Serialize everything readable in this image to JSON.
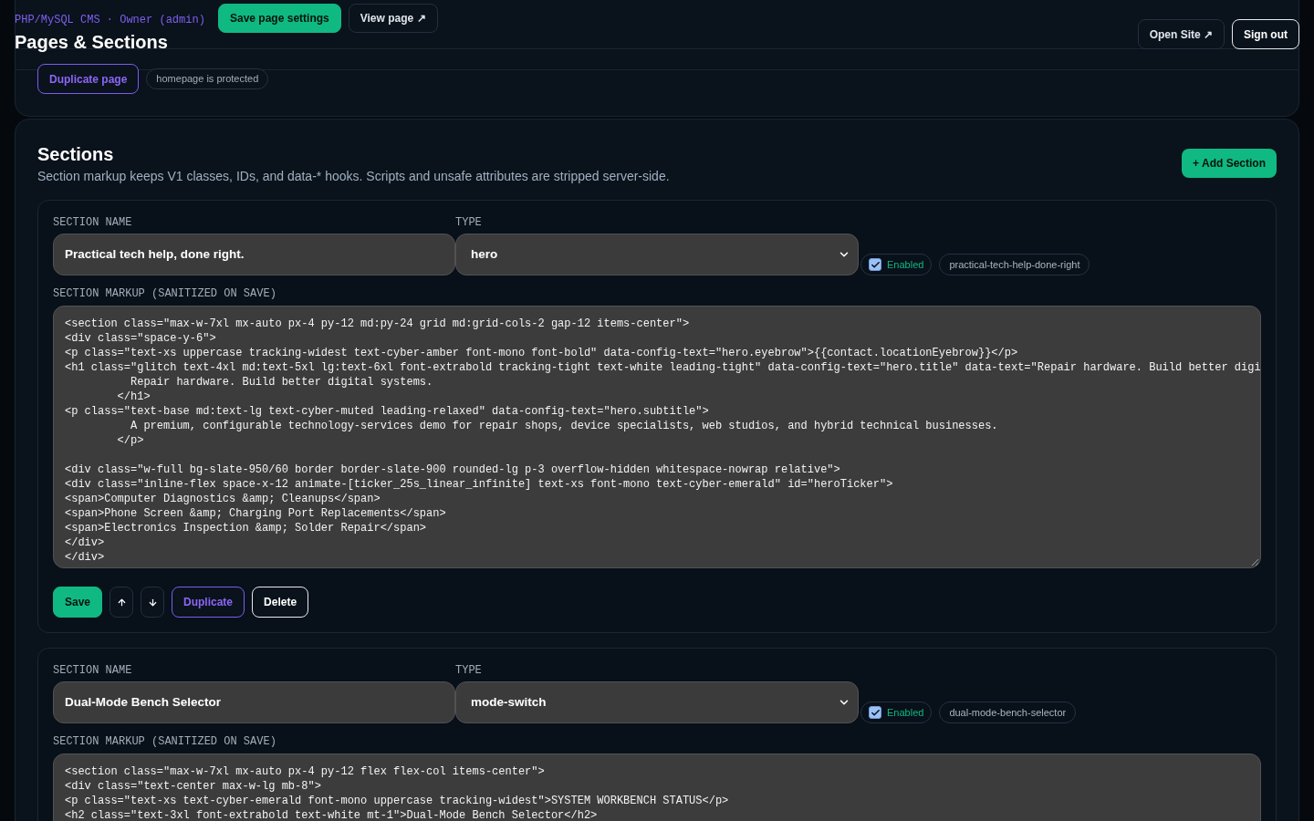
{
  "header": {
    "subtitle": "PHP/MySQL CMS · Owner (admin)",
    "title": "Pages & Sections",
    "actions": [
      {
        "label": "Open Site ↗",
        "kind": "ghost"
      },
      {
        "label": "Sign out",
        "kind": "light"
      }
    ]
  },
  "page_card": {
    "actions": [
      {
        "label": "Save page settings",
        "kind": "primary"
      },
      {
        "label": "View page ↗",
        "kind": "ghost"
      }
    ],
    "duplicate_button": "Duplicate page",
    "protected_badge": "homepage is protected"
  },
  "sections_panel": {
    "title": "Sections",
    "description": "Section markup keeps V1 classes, IDs, and data-* hooks. Scripts and unsafe attributes are stripped server-side.",
    "add_button": "+ Add Section",
    "sections": [
      {
        "name_label": "SECTION NAME",
        "name": "Practical tech help, done right.",
        "type_label": "TYPE",
        "type": "hero",
        "enabled": true,
        "enabled_label": "Enabled",
        "slug": "practical-tech-help-done-right",
        "markup_label": "SECTION MARKUP (SANITIZED ON SAVE)",
        "markup": "<section class=\"max-w-7xl mx-auto px-4 py-12 md:py-24 grid md:grid-cols-2 gap-12 items-center\">\n<div class=\"space-y-6\">\n<p class=\"text-xs uppercase tracking-widest text-cyber-amber font-mono font-bold\" data-config-text=\"hero.eyebrow\">{{contact.locationEyebrow}}</p>\n<h1 class=\"glitch text-4xl md:text-5xl lg:text-6xl font-extrabold tracking-tight text-white leading-tight\" data-config-text=\"hero.title\" data-text=\"Repair hardware. Build better digi\n          Repair hardware. Build better digital systems.\n        </h1>\n<p class=\"text-base md:text-lg text-cyber-muted leading-relaxed\" data-config-text=\"hero.subtitle\">\n          A premium, configurable technology-services demo for repair shops, device specialists, web studios, and hybrid technical businesses.\n        </p>\n\n<div class=\"w-full bg-slate-950/60 border border-slate-900 rounded-lg p-3 overflow-hidden whitespace-nowrap relative\">\n<div class=\"inline-flex space-x-12 animate-[ticker_25s_linear_infinite] text-xs font-mono text-cyber-emerald\" id=\"heroTicker\">\n<span>Computer Diagnostics &amp; Cleanups</span>\n<span>Phone Screen &amp; Charging Port Replacements</span>\n<span>Electronics Inspection &amp; Solder Repair</span>\n</div>\n</div>",
        "actions": [
          {
            "label": "Save",
            "kind": "primary"
          },
          {
            "kind": "move_up"
          },
          {
            "kind": "move_down"
          },
          {
            "label": "Duplicate",
            "kind": "accent"
          },
          {
            "label": "Delete",
            "kind": "light"
          }
        ]
      },
      {
        "name_label": "SECTION NAME",
        "name": "Dual-Mode Bench Selector",
        "type_label": "TYPE",
        "type": "mode-switch",
        "enabled": true,
        "enabled_label": "Enabled",
        "slug": "dual-mode-bench-selector",
        "markup_label": "SECTION MARKUP (SANITIZED ON SAVE)",
        "markup": "<section class=\"max-w-7xl mx-auto px-4 py-12 flex flex-col items-center\">\n<div class=\"text-center max-w-lg mb-8\">\n<p class=\"text-xs text-cyber-emerald font-mono uppercase tracking-widest\">SYSTEM WORKBENCH STATUS</p>\n<h2 class=\"text-3xl font-extrabold text-white mt-1\">Dual-Mode Bench Selector</h2>"
      }
    ]
  }
}
